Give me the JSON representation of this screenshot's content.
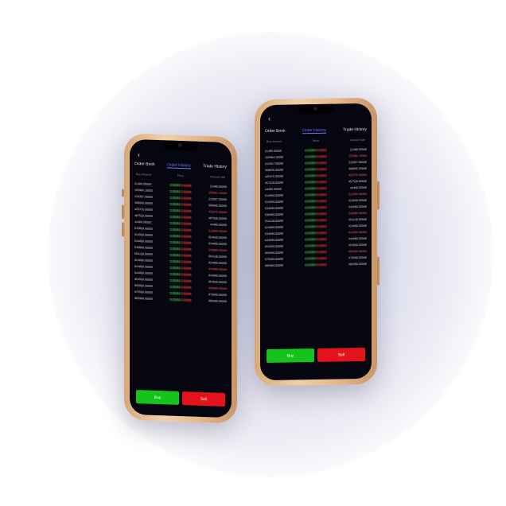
{
  "left_phone": {
    "back_icon": "‹",
    "tabs": [
      "Order Book",
      "Order History",
      "Trade History"
    ],
    "columns": [
      "Buy Amount",
      "Price",
      "Amount Sell"
    ],
    "rows": [
      [
        "21489.00000",
        "0.15052",
        "0.16061",
        "21489.00000"
      ],
      [
        "155984.10000",
        "0.15052",
        "0.16061",
        "155984.10000"
      ],
      [
        "219357.00000",
        "0.15052",
        "0.16061",
        "219357.00000"
      ],
      [
        "368695.00000",
        "0.15052",
        "0.16061",
        "368695.00000"
      ],
      [
        "425375.00000",
        "0.15052",
        "0.16061",
        "425375.00000"
      ],
      [
        "467528.00000",
        "0.15052",
        "0.16061",
        "467528.00000"
      ],
      [
        "44489.00000",
        "0.15052",
        "0.16061",
        "44489.00000"
      ],
      [
        "515899.00000",
        "0.15052",
        "0.16061",
        "515899.00000"
      ],
      [
        "524509.00000",
        "0.15052",
        "0.16061",
        "524509.00000"
      ],
      [
        "534689.00000",
        "0.15052",
        "0.16061",
        "534689.00000"
      ],
      [
        "536889.00000",
        "0.15052",
        "0.16061",
        "536889.00000"
      ],
      [
        "554128.00000",
        "0.15052",
        "0.16061",
        "554128.00000"
      ],
      [
        "624689.00000",
        "0.15052",
        "0.16061",
        "624689.00000"
      ],
      [
        "634689.00000",
        "0.15052",
        "0.16061",
        "634689.00000"
      ],
      [
        "644689.00000",
        "0.15052",
        "0.16061",
        "644689.00000"
      ],
      [
        "654509.00000",
        "0.15052",
        "0.16061",
        "654509.00000"
      ],
      [
        "665689.00000",
        "0.15052",
        "0.16061",
        "665689.00000"
      ],
      [
        "675589.00000",
        "0.15052",
        "0.16061",
        "675589.00000"
      ],
      [
        "685989.00000",
        "0.15052",
        "0.16061",
        "685989.00000"
      ]
    ],
    "buy_label": "Buy",
    "sell_label": "Sell"
  },
  "right_phone": {
    "back_icon": "‹",
    "tabs": [
      "Order Book",
      "Order History",
      "Trade History"
    ],
    "columns": [
      "Buy Amount",
      "Price",
      "Amount Sell"
    ],
    "rows": [
      [
        "21489.00000",
        "0.15052",
        "0.16061",
        "21489.00000"
      ],
      [
        "155984.10000",
        "0.15052",
        "0.16061",
        "155984.10000"
      ],
      [
        "219357.00000",
        "0.15052",
        "0.16061",
        "219357.00000"
      ],
      [
        "368695.00000",
        "0.15052",
        "0.16061",
        "368695.00000"
      ],
      [
        "425375.00000",
        "0.15052",
        "0.16061",
        "425375.00000"
      ],
      [
        "457528.00000",
        "0.15052",
        "0.16061",
        "457528.00000"
      ],
      [
        "44489.00000",
        "0.15052",
        "0.16061",
        "44489.00000"
      ],
      [
        "514589.00000",
        "0.15052",
        "0.16061",
        "514589.00000"
      ],
      [
        "524509.00000",
        "0.15052",
        "0.16061",
        "524509.00000"
      ],
      [
        "534689.00000",
        "0.15052",
        "0.16061",
        "534689.00000"
      ],
      [
        "536689.00000",
        "0.15052",
        "0.16061",
        "536689.00000"
      ],
      [
        "554128.00000",
        "0.15052",
        "0.16061",
        "554128.00000"
      ],
      [
        "624689.00000",
        "0.15052",
        "0.16061",
        "624689.00000"
      ],
      [
        "634689.00000",
        "0.15052",
        "0.16061",
        "634689.00000"
      ],
      [
        "644689.00000",
        "0.15052",
        "0.16061",
        "644689.00000"
      ],
      [
        "654509.00000",
        "0.15052",
        "0.16061",
        "654509.00000"
      ],
      [
        "665689.00000",
        "0.15052",
        "0.16061",
        "665689.00000"
      ],
      [
        "675689.00000",
        "0.15052",
        "0.16061",
        "675689.00000"
      ],
      [
        "685989.00000",
        "0.15052",
        "0.16061",
        "685989.00000"
      ]
    ],
    "buy_label": "Buy",
    "sell_label": "Sell"
  },
  "colors": {
    "buy": "#16c21c",
    "sell": "#e3121b",
    "active_tab": "#6f78ff",
    "screen_bg": "#05060f",
    "frame": "#e7b98c"
  }
}
